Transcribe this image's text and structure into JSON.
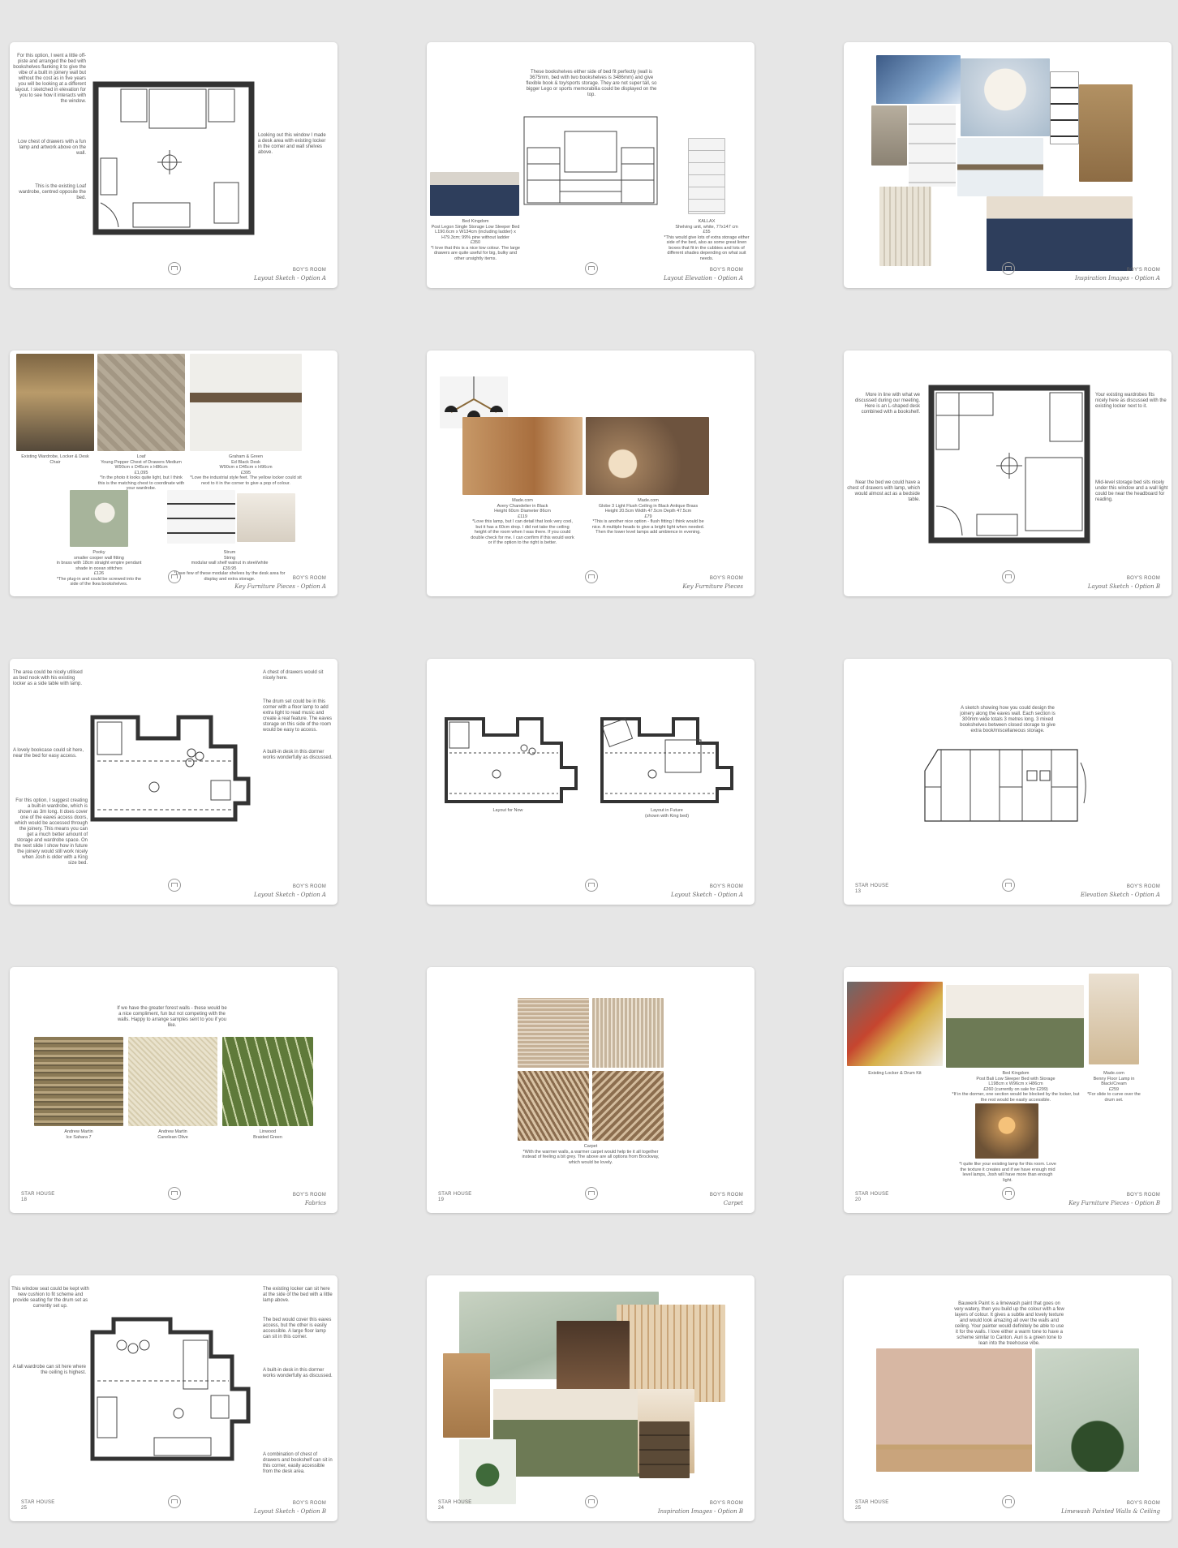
{
  "pages": [
    {
      "project": "",
      "room": "BOY'S ROOM",
      "subtitle": "Layout Sketch - Option A",
      "notes": [
        "For this option, I went a little off-piste and arranged the bed with bookshelves flanking it to give the vibe of a built in joinery wall but without the cost as in five years you will be looking at a different layout. I sketched in elevation for you to see how it interacts with the window.",
        "Low chest of drawers with a fun lamp and artwork above on the wall.",
        "This is the existing Loaf wardrobe, centred opposite the bed.",
        "Looking out this window I made a desk area with existing locker in the corner and wall shelves above."
      ]
    },
    {
      "project": "",
      "room": "BOY'S ROOM",
      "subtitle": "Layout Elevation - Option A",
      "notes": [
        "These bookshelves either side of bed fit perfectly (wall is 3675mm, bed with two bookshelves is 3486mm) and give flexible book & toy/sports storage. They are not super tall, so bigger Lego or sports memorabilia could be displayed on the top.",
        "Bed Kingdom\nPost Legon Single Storage Low Sleeper Bed\nL190.6cm x W134cm (including ladder) x H79.3cm; 99% pine without ladder\n£350\n*I love that this is a nice low colour. The large drawers are quite useful for big, bulky and other unsightly items.",
        "KALLAX\nShelving unit, white, 77x147 cm\n£55\n*This would give lots of extra storage either side of the bed, also as some great linen boxes that fit in the cubbies and lots of different shades depending on what suit needs."
      ]
    },
    {
      "project": "",
      "room": "BOY'S ROOM",
      "subtitle": "Inspiration Images - Option A",
      "notes": []
    },
    {
      "project": "",
      "room": "BOY'S ROOM",
      "subtitle": "Key Furniture Pieces - Option A",
      "notes": [
        "Existing Wardrobe, Locker & Desk Chair",
        "Loaf\nYoung Pepper Chest of Drawers Medium\nW90cm x D45cm x H86cm\n£1,095\n*In the photo it looks quite light, but I think this is the matching chest to coordinate with your wardrobe.",
        "Graham & Green\nEd Black Desk\nW90cm x D45cm x H96cm\n£395\n*Love the industrial style feet. The yellow locker could sit next to it in the corner to give a pop of colour.",
        "Pooky\nsmaller cooper wall fitting\nin brass with 18cm straight empire pendant shade in ocean stitches\n£126\n*The plug-in and could be screwed into the side of the Ikea bookshelves.",
        "Strum\nString\nmodular wall shelf walnut in steel/white\n£39.95\n*Love few of these modular shelves by the desk area for display and extra storage."
      ]
    },
    {
      "project": "",
      "room": "BOY'S ROOM",
      "subtitle": "Key Furniture Pieces",
      "notes": [
        "Made.com\nAvery Chandelier in Black\nHeight 60cm Diameter 86cm\n£119\n*Love this lamp, but I can detail that look very cool, but it has a 60cm drop. I did not take the ceiling height of the room when I was there. If you could double check for me. I can confirm if this would work or if the option to the right is better.",
        "Made.com\nGlobe 3 Light Flush Ceiling in Black Antique Brass\nHeight 20.5cm Width 47.5cm Depth 47.5cm\n£79\n*This is another nice option - flush fitting I think would be nice. A multiple heads to give a bright light when needed. Then the lower level lamps add ambience in evening."
      ]
    },
    {
      "project": "",
      "room": "BOY'S ROOM",
      "subtitle": "Layout Sketch - Option B",
      "notes": [
        "More in line with what we discussed during our meeting. Here is an L-shaped desk combined with a bookshelf.",
        "Near the bed we could have a chest of drawers with lamp, which would almost act as a bedside table.",
        "Your existing wardrobes fits nicely here as discussed with the existing locker next to it.",
        "Mid-level storage bed sits nicely under this window and a wall light could be near the headboard for reading."
      ]
    },
    {
      "project": "",
      "room": "BOY'S ROOM",
      "subtitle": "Layout Sketch - Option A",
      "notes": [
        "The area could be nicely utilised as bed nook with his existing locker as a side table with lamp.",
        "A lovely bookcase could sit here, near the bed for easy access.",
        "For this option, I suggest creating a built-in wardrobe, which is shown as 3m long. It does cover one of the eaves access doors, which would be accessed through the joinery. This means you can get a much better amount of storage and wardrobe space. On the next slide I show how in future the joinery would still work nicely when Josh is older with a King size bed.",
        "A chest of drawers would sit nicely here.",
        "The drum set could be in this corner with a floor lamp to add extra light to read music and create a real feature. The eaves storage on this side of the room would be easy to access.",
        "A built-in desk in this dormer works wonderfully as discussed."
      ]
    },
    {
      "project": "",
      "room": "BOY'S ROOM",
      "subtitle": "Layout Sketch - Option A",
      "notes": [
        "Layout for Now",
        "Layout in Future\n(shown with King bed)"
      ]
    },
    {
      "project": "STAR HOUSE\n13",
      "room": "BOY'S ROOM",
      "subtitle": "Elevation Sketch - Option A",
      "notes": [
        "A sketch showing how you could design the joinery along the eaves wall. Each section is 300mm wide totals 3 metres long. 3 mixed bookshelves between closed storage to give extra book/miscellaneous storage."
      ]
    },
    {
      "project": "STAR HOUSE\n18",
      "room": "BOY'S ROOM",
      "subtitle": "Fabrics",
      "notes": [
        "If we have the greater forest walls - these would be a nice compliment, fun but not competing with the walls. Happy to arrange samples sent to you if you like.",
        "Andrew Martin\nIce Sahara 7",
        "Andrew Martin\nCanelean Olive",
        "Linwood\nBraided Green"
      ]
    },
    {
      "project": "STAR HOUSE\n19",
      "room": "BOY'S ROOM",
      "subtitle": "Carpet",
      "notes": [
        "Carpet\n*With the warmer walls, a warmer carpet would help tie it all together instead of feeling a bit grey. The above are all options from Brockway, which would be lovely."
      ]
    },
    {
      "project": "STAR HOUSE\n20",
      "room": "BOY'S ROOM",
      "subtitle": "Key Furniture Pieces - Option B",
      "notes": [
        "Existing Locker & Drum Kit",
        "Bed Kingdom\nPost Bali Low Sleeper Bed with Storage\nL198cm x W96cm x H86cm\n£260 (currently on sale for £299)\n*If in the dormer, one section would be blocked by the locker, but the rest would be easily accessible.",
        "Made.com\nBenny Floor Lamp in Black/Cream\n£259\n*For slide to curve over the drum set.",
        "*I quite like your existing lamp for this room. Love the texture it creates and if we have enough mid level lamps, Josh will have more than enough light."
      ]
    },
    {
      "project": "STAR HOUSE\n25",
      "room": "BOY'S ROOM",
      "subtitle": "Layout Sketch - Option B",
      "notes": [
        "This window seat could be kept with new cushion to fit scheme and provide seating for the drum set as currently set up.",
        "A tall wardrobe can sit here where the ceiling is highest.",
        "The existing locker can sit here at the side of the bed with a little lamp above.",
        "The bed would cover this eaves access, but the other is easily accessible. A large floor lamp can sit in this corner.",
        "A built-in desk in this dormer works wonderfully as discussed.",
        "A combination of chest of drawers and bookshelf can sit in this corner, easily accessible from the desk area."
      ]
    },
    {
      "project": "STAR HOUSE\n24",
      "room": "BOY'S ROOM",
      "subtitle": "Inspiration Images - Option B",
      "notes": []
    },
    {
      "project": "STAR HOUSE\n25",
      "room": "BOY'S ROOM",
      "subtitle": "Limewash Painted Walls & Ceiling",
      "notes": [
        "Bauwerk Paint is a limewash paint that goes on very watery, then you build up the colour with a few layers of colour. It gives a subtle and lovely texture and would look amazing all over the walls and ceiling. Your painter would definitely be able to use it for the walls. I love either a warm tone to have a scheme similar to Canton. Auri is a green tone to lean into the treehouse vibe."
      ]
    }
  ],
  "colors": {
    "background": "#e6e6e6",
    "page": "#ffffff",
    "navy_bed": "#2e3e5c",
    "olive_bed": "#6d7a55",
    "oak": "#a88a5f",
    "terracotta": "#c7a591",
    "sage": "#bcc8b4"
  }
}
